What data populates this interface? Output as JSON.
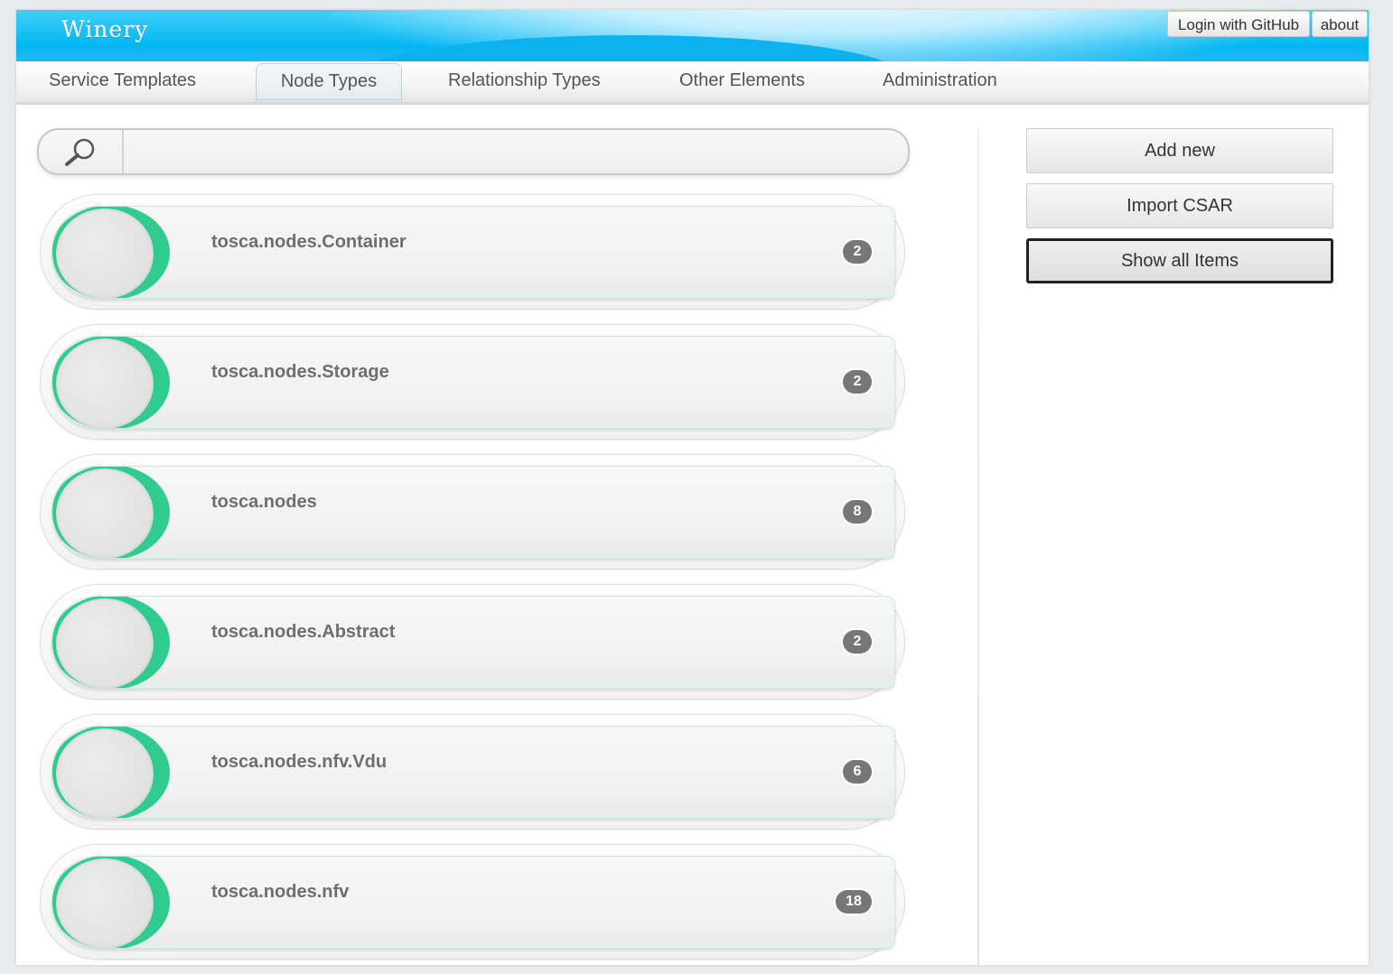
{
  "header": {
    "brand": "Winery",
    "login_label": "Login with GitHub",
    "about_label": "about"
  },
  "nav": {
    "tabs": [
      {
        "label": "Service Templates",
        "active": false
      },
      {
        "label": "Node Types",
        "active": true
      },
      {
        "label": "Relationship Types",
        "active": false
      },
      {
        "label": "Other Elements",
        "active": false
      },
      {
        "label": "Administration",
        "active": false
      }
    ]
  },
  "search": {
    "value": "",
    "icon": "search-icon"
  },
  "list": {
    "items": [
      {
        "name": "tosca.nodes.Container",
        "count": "2"
      },
      {
        "name": "tosca.nodes.Storage",
        "count": "2"
      },
      {
        "name": "tosca.nodes",
        "count": "8"
      },
      {
        "name": "tosca.nodes.Abstract",
        "count": "2"
      },
      {
        "name": "tosca.nodes.nfv.Vdu",
        "count": "6"
      },
      {
        "name": "tosca.nodes.nfv",
        "count": "18"
      }
    ]
  },
  "actions": {
    "add_new": "Add new",
    "import_csar": "Import CSAR",
    "show_all": "Show all Items"
  },
  "colors": {
    "header": "#04b6f3",
    "accent_ring": "#2fcb8f",
    "badge": "#777777"
  }
}
